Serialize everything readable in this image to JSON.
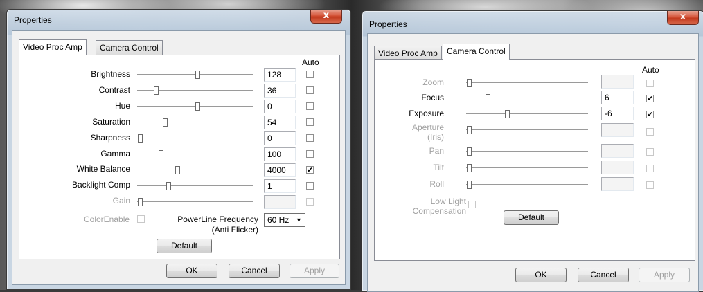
{
  "left_dialog": {
    "title": "Properties",
    "close_glyph": "x",
    "tabs": [
      "Video Proc Amp",
      "Camera Control"
    ],
    "auto_header": "Auto",
    "rows": [
      {
        "label": "Brightness",
        "value": "128",
        "auto": ""
      },
      {
        "label": "Contrast",
        "value": "36",
        "auto": ""
      },
      {
        "label": "Hue",
        "value": "0",
        "auto": ""
      },
      {
        "label": "Saturation",
        "value": "54",
        "auto": ""
      },
      {
        "label": "Sharpness",
        "value": "0",
        "auto": ""
      },
      {
        "label": "Gamma",
        "value": "100",
        "auto": ""
      },
      {
        "label": "White Balance",
        "value": "4000",
        "auto": "✔"
      },
      {
        "label": "Backlight Comp",
        "value": "1",
        "auto": ""
      },
      {
        "label": "Gain",
        "value": "",
        "auto": ""
      }
    ],
    "color_enable_label": "ColorEnable",
    "powerline_label_1": "PowerLine Frequency",
    "powerline_label_2": "(Anti Flicker)",
    "powerline_value": "60 Hz",
    "default_label": "Default",
    "ok_label": "OK",
    "cancel_label": "Cancel",
    "apply_label": "Apply"
  },
  "right_dialog": {
    "title": "Properties",
    "close_glyph": "x",
    "tabs": [
      "Video Proc Amp",
      "Camera Control"
    ],
    "auto_header": "Auto",
    "rows": [
      {
        "label": "Zoom",
        "value": "",
        "auto": ""
      },
      {
        "label": "Focus",
        "value": "6",
        "auto": "✔"
      },
      {
        "label": "Exposure",
        "value": "-6",
        "auto": "✔"
      },
      {
        "label": "Aperture",
        "label2": "(Iris)",
        "value": "",
        "auto": ""
      },
      {
        "label": "Pan",
        "value": "",
        "auto": ""
      },
      {
        "label": "Tilt",
        "value": "",
        "auto": ""
      },
      {
        "label": "Roll",
        "value": "",
        "auto": ""
      }
    ],
    "low_light_label_1": "Low Light",
    "low_light_label_2": "Compensation",
    "default_label": "Default",
    "ok_label": "OK",
    "cancel_label": "Cancel",
    "apply_label": "Apply"
  }
}
